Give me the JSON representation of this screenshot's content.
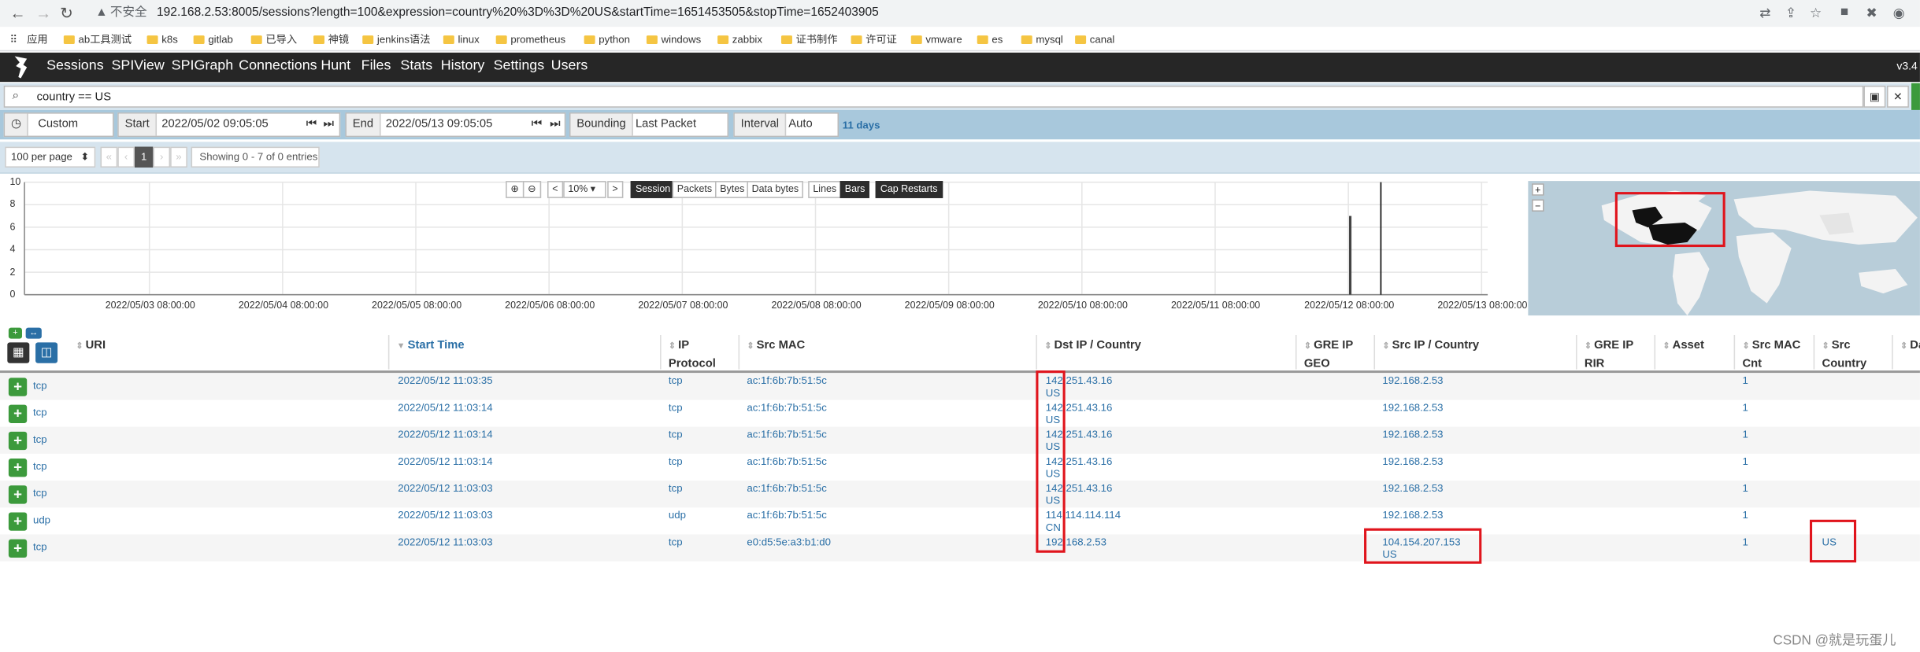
{
  "browser": {
    "security_label": "不安全",
    "url": "192.168.2.53:8005/sessions?length=100&expression=country%20%3D%3D%20US&startTime=1651453505&stopTime=1652403905",
    "bookmarks_label": "应用",
    "bookmarks": [
      "ab工具测试",
      "k8s",
      "gitlab",
      "已导入",
      "神镜",
      "jenkins语法",
      "linux",
      "prometheus",
      "python",
      "windows",
      "zabbix",
      "证书制作",
      "许可证",
      "vmware",
      "es",
      "mysql",
      "canal"
    ]
  },
  "nav": {
    "items": [
      "Sessions",
      "SPIView",
      "SPIGraph",
      "Connections",
      "Hunt",
      "Files",
      "Stats",
      "History",
      "Settings",
      "Users"
    ],
    "version": "v3.4"
  },
  "search": {
    "expression": "country == US"
  },
  "time": {
    "range": "Custom",
    "start_label": "Start",
    "start_value": "2022/05/02 09:05:05",
    "end_label": "End",
    "end_value": "2022/05/13 09:05:05",
    "bounding_label": "Bounding",
    "bounding_value": "Last Packet",
    "interval_label": "Interval",
    "interval_value": "Auto",
    "duration": "11 days"
  },
  "pager": {
    "per_page": "100 per page",
    "current": "1",
    "info": "Showing 0 - 7 of 0 entries"
  },
  "chart_controls": {
    "zoom": "10%",
    "modes": [
      "Session",
      "Packets",
      "Bytes",
      "Data bytes"
    ],
    "styles": [
      "Lines",
      "Bars"
    ],
    "cap": "Cap Restarts"
  },
  "chart_data": {
    "type": "bar",
    "y_ticks": [
      "10",
      "8",
      "6",
      "4",
      "2",
      "0"
    ],
    "x_ticks": [
      "2022/05/03 08:00:00",
      "2022/05/04 08:00:00",
      "2022/05/05 08:00:00",
      "2022/05/06 08:00:00",
      "2022/05/07 08:00:00",
      "2022/05/08 08:00:00",
      "2022/05/09 08:00:00",
      "2022/05/10 08:00:00",
      "2022/05/11 08:00:00",
      "2022/05/12 08:00:00",
      "2022/05/13 08:00:00"
    ],
    "ylim": [
      0,
      10
    ],
    "series": [
      {
        "values": [
          {
            "x": "2022/05/12 11:00",
            "y": 7
          }
        ]
      }
    ]
  },
  "table": {
    "headers": [
      {
        "label": "URI"
      },
      {
        "label": "Start Time"
      },
      {
        "label": "IP Protocol",
        "l1": "IP",
        "l2": "Protocol"
      },
      {
        "label": "Src MAC"
      },
      {
        "label": "Dst IP / Country"
      },
      {
        "label": "GRE IP GEO",
        "l1": "GRE IP",
        "l2": "GEO"
      },
      {
        "label": "Src IP / Country"
      },
      {
        "label": "GRE IP RIR",
        "l1": "GRE IP",
        "l2": "RIR"
      },
      {
        "label": "Asset"
      },
      {
        "label": "Src MAC Cnt",
        "l1": "Src MAC",
        "l2": "Cnt"
      },
      {
        "label": "Src Country",
        "l1": "Src",
        "l2": "Country"
      },
      {
        "label": "Da"
      }
    ],
    "rows": [
      {
        "uri": "tcp",
        "start": "2022/05/12 11:03:35",
        "proto": "tcp",
        "mac": "ac:1f:6b:7b:51:5c",
        "dst_ip": "142.251.43.16",
        "dst_cc": "US",
        "src_ip": "192.168.2.53",
        "src_cc": "",
        "cnt": "1",
        "src_country": ""
      },
      {
        "uri": "tcp",
        "start": "2022/05/12 11:03:14",
        "proto": "tcp",
        "mac": "ac:1f:6b:7b:51:5c",
        "dst_ip": "142.251.43.16",
        "dst_cc": "US",
        "src_ip": "192.168.2.53",
        "src_cc": "",
        "cnt": "1",
        "src_country": ""
      },
      {
        "uri": "tcp",
        "start": "2022/05/12 11:03:14",
        "proto": "tcp",
        "mac": "ac:1f:6b:7b:51:5c",
        "dst_ip": "142.251.43.16",
        "dst_cc": "US",
        "src_ip": "192.168.2.53",
        "src_cc": "",
        "cnt": "1",
        "src_country": ""
      },
      {
        "uri": "tcp",
        "start": "2022/05/12 11:03:14",
        "proto": "tcp",
        "mac": "ac:1f:6b:7b:51:5c",
        "dst_ip": "142.251.43.16",
        "dst_cc": "US",
        "src_ip": "192.168.2.53",
        "src_cc": "",
        "cnt": "1",
        "src_country": ""
      },
      {
        "uri": "tcp",
        "start": "2022/05/12 11:03:03",
        "proto": "tcp",
        "mac": "ac:1f:6b:7b:51:5c",
        "dst_ip": "142.251.43.16",
        "dst_cc": "US",
        "src_ip": "192.168.2.53",
        "src_cc": "",
        "cnt": "1",
        "src_country": ""
      },
      {
        "uri": "udp",
        "start": "2022/05/12 11:03:03",
        "proto": "udp",
        "mac": "ac:1f:6b:7b:51:5c",
        "dst_ip": "114.114.114.114",
        "dst_cc": "CN",
        "src_ip": "192.168.2.53",
        "src_cc": "",
        "cnt": "1",
        "src_country": ""
      },
      {
        "uri": "tcp",
        "start": "2022/05/12 11:03:03",
        "proto": "tcp",
        "mac": "e0:d5:5e:a3:b1:d0",
        "dst_ip": "192.168.2.53",
        "dst_cc": "",
        "src_ip": "104.154.207.153",
        "src_cc": "US",
        "cnt": "1",
        "src_country": "US"
      }
    ]
  },
  "watermark": "CSDN @就是玩蛋儿",
  "colors": {
    "nav_bg": "#262626",
    "link": "#2a6fa6",
    "highlight": "#e0141c",
    "expand": "#3c9a3c"
  }
}
